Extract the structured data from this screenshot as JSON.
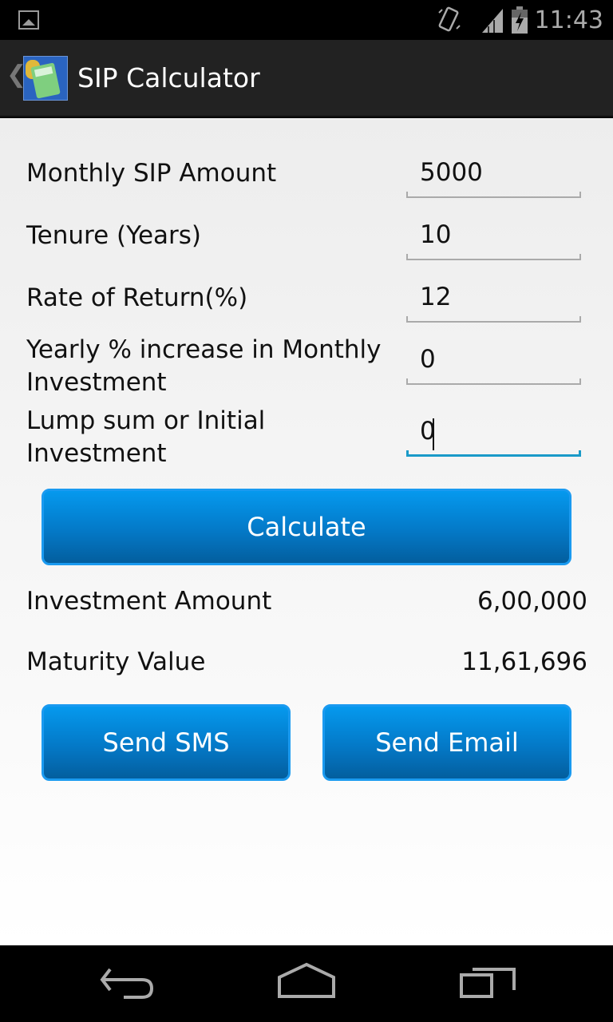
{
  "status_bar": {
    "time": "11:43",
    "icons": [
      "gallery-notification-icon",
      "vibrate-icon",
      "signal-icon",
      "battery-charging-icon"
    ]
  },
  "action_bar": {
    "title": "SIP Calculator",
    "app_icon": "calculator-coins-icon"
  },
  "form": {
    "fields": [
      {
        "label": "Monthly SIP Amount",
        "value": "5000"
      },
      {
        "label": "Tenure (Years)",
        "value": "10"
      },
      {
        "label": "Rate of Return(%)",
        "value": "12"
      },
      {
        "label": "Yearly % increase in Monthly Investment",
        "label_line1": "Yearly % increase in Monthly",
        "label_line2": "Investment",
        "value": "0"
      },
      {
        "label": "Lump sum or Initial Investment",
        "label_line1": "Lump sum or Initial",
        "label_line2": "Investment",
        "value": "0",
        "focused": true
      }
    ],
    "calculate_label": "Calculate"
  },
  "results": {
    "investment_label": "Investment Amount",
    "investment_value": "6,00,000",
    "maturity_label": "Maturity Value",
    "maturity_value": "11,61,696"
  },
  "actions": {
    "send_sms_label": "Send SMS",
    "send_email_label": "Send Email"
  },
  "colors": {
    "button_top": "#0599ee",
    "button_bottom": "#035e9e",
    "focus_accent": "#1a9ac8",
    "action_bar": "#222222"
  },
  "nav_bar": {
    "buttons": [
      "back",
      "home",
      "recent-apps"
    ]
  }
}
